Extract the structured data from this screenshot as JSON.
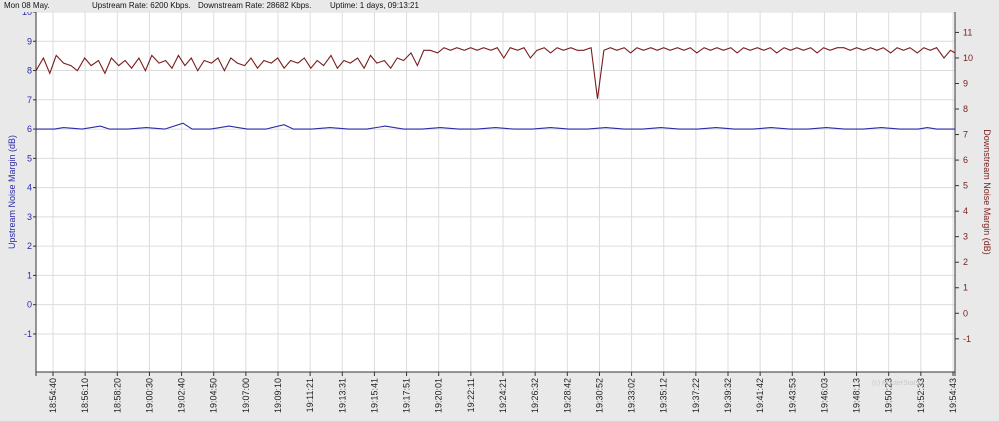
{
  "header": {
    "date": "Mon 08 May.",
    "upstream_rate": "Upstream Rate: 6200 Kbps.",
    "downstream_rate": "Downstream Rate: 28682 Kbps.",
    "uptime": "Uptime: 1 days, 09:13:21"
  },
  "watermark": "(c) RouterStats...",
  "colors": {
    "upstream": "#2a2aa8",
    "downstream": "#7a1c1c",
    "grid": "#dcdcdc",
    "plot_bg": "#ffffff"
  },
  "chart_data": {
    "type": "line",
    "grid": true,
    "x_tick_labels": [
      "18:54:40",
      "18:56:10",
      "18:58:20",
      "19:00:30",
      "19:02:40",
      "19:04:50",
      "19:07:00",
      "19:09:10",
      "19:11:21",
      "19:13:31",
      "19:15:41",
      "19:17:51",
      "19:20:01",
      "19:22:11",
      "19:24:21",
      "19:26:32",
      "19:28:42",
      "19:30:52",
      "19:33:02",
      "19:35:12",
      "19:37:22",
      "19:39:32",
      "19:41:42",
      "19:43:53",
      "19:46:03",
      "19:48:13",
      "19:50:23",
      "19:52:33",
      "19:54:43"
    ],
    "left_axis": {
      "label": "Upstream Noise Margin (dB)",
      "range": [
        -2.3,
        10
      ],
      "ticks": [
        10,
        9,
        8,
        7,
        6,
        5,
        4,
        3,
        2,
        1,
        0,
        -1
      ]
    },
    "right_axis": {
      "label": "Downstream Noise Margin (dB)",
      "range": [
        -2.3,
        11.8
      ],
      "ticks": [
        11,
        10,
        9,
        8,
        7,
        6,
        5,
        4,
        3,
        2,
        1,
        0,
        -1
      ]
    },
    "series": [
      {
        "name": "Upstream Noise Margin (dB)",
        "axis": "left",
        "color": "#2a2aa8",
        "points": [
          [
            0,
            6.0
          ],
          [
            2,
            6.0
          ],
          [
            3,
            6.05
          ],
          [
            5,
            6.0
          ],
          [
            7,
            6.1
          ],
          [
            8,
            6.0
          ],
          [
            10,
            6.0
          ],
          [
            12,
            6.05
          ],
          [
            14,
            6.0
          ],
          [
            16,
            6.2
          ],
          [
            17,
            6.0
          ],
          [
            19,
            6.0
          ],
          [
            21,
            6.1
          ],
          [
            23,
            6.0
          ],
          [
            25,
            6.0
          ],
          [
            27,
            6.15
          ],
          [
            28,
            6.0
          ],
          [
            30,
            6.0
          ],
          [
            32,
            6.05
          ],
          [
            34,
            6.0
          ],
          [
            36,
            6.0
          ],
          [
            38,
            6.1
          ],
          [
            40,
            6.0
          ],
          [
            42,
            6.0
          ],
          [
            44,
            6.05
          ],
          [
            46,
            6.0
          ],
          [
            48,
            6.0
          ],
          [
            50,
            6.05
          ],
          [
            52,
            6.0
          ],
          [
            54,
            6.0
          ],
          [
            56,
            6.05
          ],
          [
            58,
            6.0
          ],
          [
            60,
            6.0
          ],
          [
            62,
            6.05
          ],
          [
            64,
            6.0
          ],
          [
            66,
            6.0
          ],
          [
            68,
            6.05
          ],
          [
            70,
            6.0
          ],
          [
            72,
            6.0
          ],
          [
            74,
            6.05
          ],
          [
            76,
            6.0
          ],
          [
            78,
            6.0
          ],
          [
            80,
            6.05
          ],
          [
            82,
            6.0
          ],
          [
            84,
            6.0
          ],
          [
            86,
            6.05
          ],
          [
            88,
            6.0
          ],
          [
            90,
            6.0
          ],
          [
            92,
            6.05
          ],
          [
            94,
            6.0
          ],
          [
            96,
            6.0
          ],
          [
            97,
            6.05
          ],
          [
            98,
            6.0
          ],
          [
            100,
            6.0
          ]
        ]
      },
      {
        "name": "Downstream Noise Margin (dB)",
        "axis": "right",
        "color": "#7a1c1c",
        "points": [
          [
            0,
            9.5
          ],
          [
            0.8,
            10.0
          ],
          [
            1.5,
            9.4
          ],
          [
            2.2,
            10.1
          ],
          [
            3,
            9.8
          ],
          [
            3.8,
            9.7
          ],
          [
            4.5,
            9.5
          ],
          [
            5.3,
            10.0
          ],
          [
            6,
            9.7
          ],
          [
            6.8,
            9.9
          ],
          [
            7.5,
            9.4
          ],
          [
            8.2,
            10.0
          ],
          [
            9,
            9.7
          ],
          [
            9.7,
            9.9
          ],
          [
            10.4,
            9.6
          ],
          [
            11.2,
            10.0
          ],
          [
            11.9,
            9.5
          ],
          [
            12.6,
            10.1
          ],
          [
            13.4,
            9.8
          ],
          [
            14.1,
            9.9
          ],
          [
            14.8,
            9.6
          ],
          [
            15.5,
            10.1
          ],
          [
            16.2,
            9.7
          ],
          [
            16.9,
            10.0
          ],
          [
            17.6,
            9.5
          ],
          [
            18.3,
            9.9
          ],
          [
            19.1,
            9.8
          ],
          [
            19.8,
            10.0
          ],
          [
            20.5,
            9.5
          ],
          [
            21.2,
            10.0
          ],
          [
            21.9,
            9.8
          ],
          [
            22.7,
            9.7
          ],
          [
            23.4,
            10.0
          ],
          [
            24.1,
            9.6
          ],
          [
            24.8,
            9.9
          ],
          [
            25.6,
            9.8
          ],
          [
            26.3,
            10.0
          ],
          [
            27.0,
            9.6
          ],
          [
            27.7,
            9.9
          ],
          [
            28.5,
            9.8
          ],
          [
            29.2,
            10.0
          ],
          [
            29.9,
            9.6
          ],
          [
            30.6,
            9.9
          ],
          [
            31.3,
            9.7
          ],
          [
            32.1,
            10.1
          ],
          [
            32.8,
            9.6
          ],
          [
            33.5,
            9.9
          ],
          [
            34.2,
            9.8
          ],
          [
            35.0,
            10.0
          ],
          [
            35.7,
            9.6
          ],
          [
            36.4,
            10.1
          ],
          [
            37.1,
            9.8
          ],
          [
            37.9,
            9.9
          ],
          [
            38.6,
            9.6
          ],
          [
            39.3,
            10.0
          ],
          [
            40.0,
            9.9
          ],
          [
            40.8,
            10.2
          ],
          [
            41.5,
            9.7
          ],
          [
            42.2,
            10.3
          ],
          [
            42.9,
            10.3
          ],
          [
            43.7,
            10.2
          ],
          [
            44.4,
            10.4
          ],
          [
            45.1,
            10.3
          ],
          [
            45.8,
            10.4
          ],
          [
            46.6,
            10.3
          ],
          [
            47.3,
            10.4
          ],
          [
            48.0,
            10.3
          ],
          [
            48.7,
            10.4
          ],
          [
            49.5,
            10.3
          ],
          [
            50.2,
            10.4
          ],
          [
            50.9,
            10.0
          ],
          [
            51.6,
            10.4
          ],
          [
            52.4,
            10.3
          ],
          [
            53.1,
            10.4
          ],
          [
            53.8,
            10.0
          ],
          [
            54.5,
            10.3
          ],
          [
            55.3,
            10.4
          ],
          [
            56.0,
            10.2
          ],
          [
            56.7,
            10.4
          ],
          [
            57.4,
            10.3
          ],
          [
            58.2,
            10.4
          ],
          [
            58.9,
            10.3
          ],
          [
            59.6,
            10.3
          ],
          [
            60.4,
            10.4
          ],
          [
            61.1,
            8.4
          ],
          [
            61.8,
            10.3
          ],
          [
            62.5,
            10.4
          ],
          [
            63.2,
            10.3
          ],
          [
            64.0,
            10.4
          ],
          [
            64.7,
            10.2
          ],
          [
            65.4,
            10.4
          ],
          [
            66.1,
            10.3
          ],
          [
            66.9,
            10.4
          ],
          [
            67.6,
            10.3
          ],
          [
            68.3,
            10.4
          ],
          [
            69.0,
            10.3
          ],
          [
            69.8,
            10.4
          ],
          [
            70.5,
            10.3
          ],
          [
            71.2,
            10.4
          ],
          [
            71.9,
            10.2
          ],
          [
            72.7,
            10.4
          ],
          [
            73.4,
            10.3
          ],
          [
            74.1,
            10.4
          ],
          [
            74.8,
            10.3
          ],
          [
            75.6,
            10.4
          ],
          [
            76.3,
            10.2
          ],
          [
            77.0,
            10.4
          ],
          [
            77.7,
            10.3
          ],
          [
            78.5,
            10.4
          ],
          [
            79.2,
            10.3
          ],
          [
            79.9,
            10.4
          ],
          [
            80.6,
            10.2
          ],
          [
            81.4,
            10.4
          ],
          [
            82.1,
            10.3
          ],
          [
            82.8,
            10.4
          ],
          [
            83.5,
            10.3
          ],
          [
            84.3,
            10.4
          ],
          [
            85.0,
            10.2
          ],
          [
            85.7,
            10.4
          ],
          [
            86.4,
            10.3
          ],
          [
            87.2,
            10.4
          ],
          [
            87.9,
            10.4
          ],
          [
            88.6,
            10.3
          ],
          [
            89.3,
            10.4
          ],
          [
            90.1,
            10.3
          ],
          [
            90.8,
            10.4
          ],
          [
            91.5,
            10.3
          ],
          [
            92.2,
            10.4
          ],
          [
            93.0,
            10.2
          ],
          [
            93.7,
            10.4
          ],
          [
            94.4,
            10.3
          ],
          [
            95.1,
            10.4
          ],
          [
            95.9,
            10.2
          ],
          [
            96.6,
            10.4
          ],
          [
            97.3,
            10.3
          ],
          [
            98.0,
            10.4
          ],
          [
            98.8,
            10.0
          ],
          [
            99.5,
            10.3
          ],
          [
            100,
            10.2
          ]
        ]
      }
    ]
  }
}
